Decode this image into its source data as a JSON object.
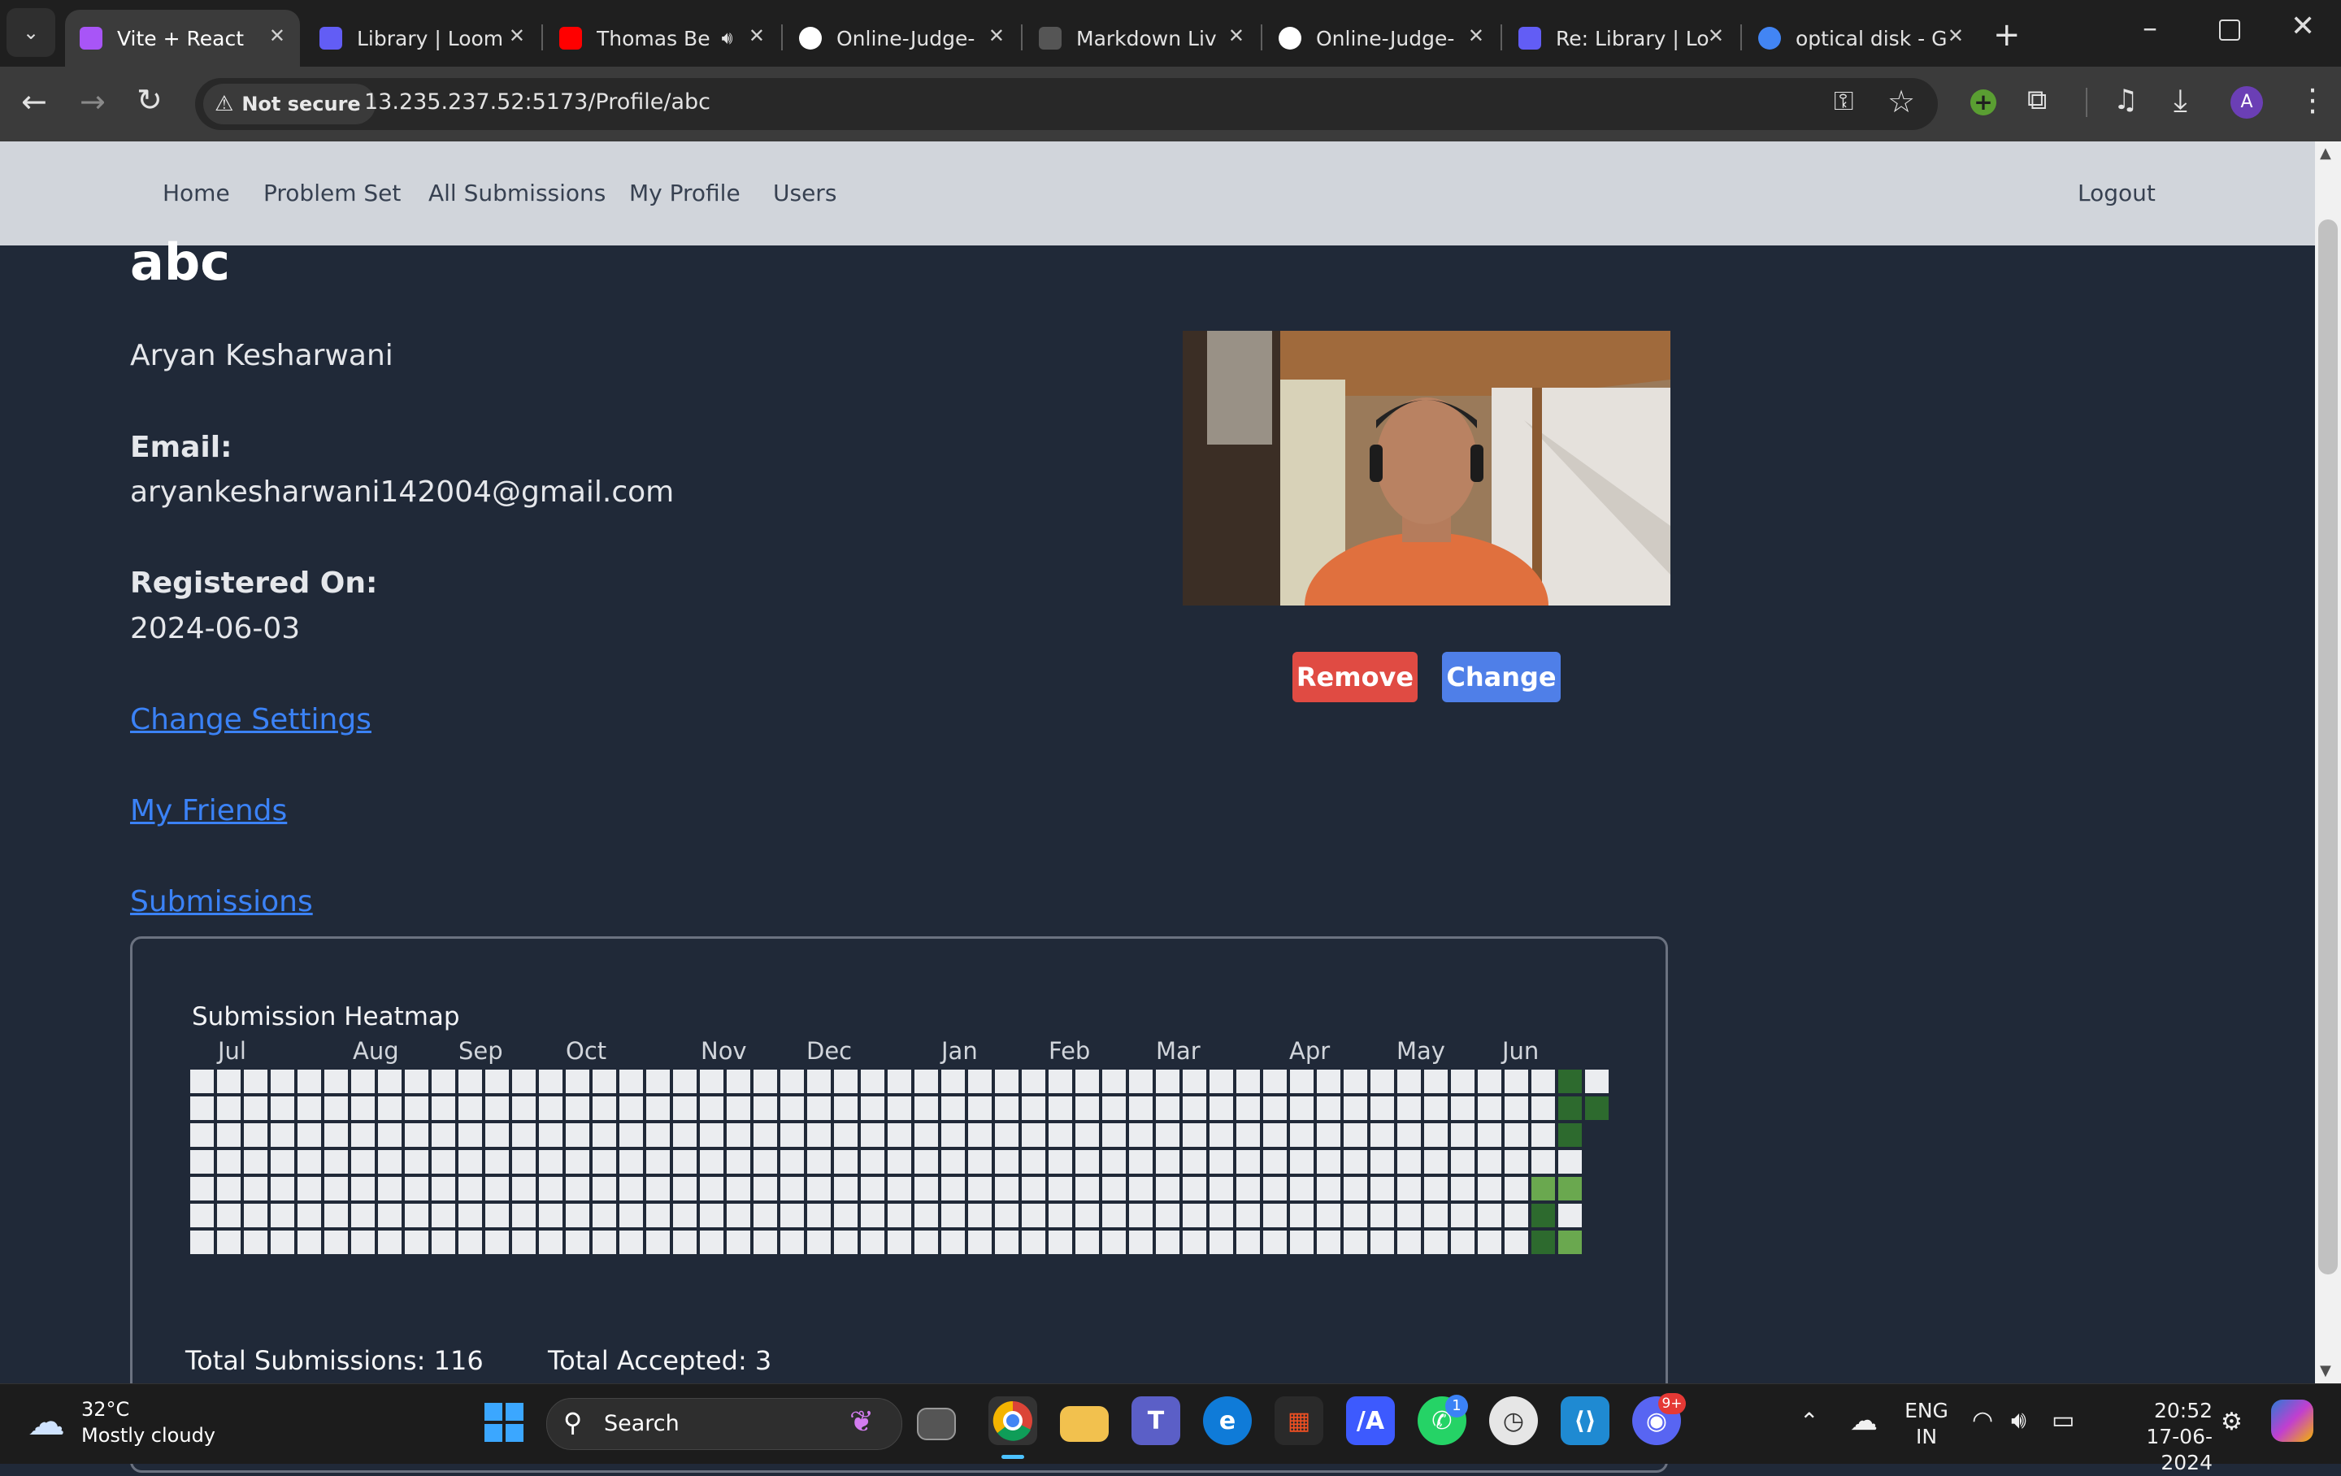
{
  "browser": {
    "tabs": [
      {
        "title": "Vite + React",
        "favicon": "vite-icon",
        "color": "#a855f7",
        "active": true
      },
      {
        "title": "Library | Loom",
        "favicon": "loom-icon",
        "color": "#625df5"
      },
      {
        "title": "Thomas Be",
        "favicon": "youtube-icon",
        "color": "#ff0000",
        "audio": true
      },
      {
        "title": "Online-Judge-",
        "favicon": "github-icon",
        "color": "#ffffff"
      },
      {
        "title": "Markdown Liv",
        "favicon": "markdown-icon",
        "color": "#555555"
      },
      {
        "title": "Online-Judge-",
        "favicon": "github-icon",
        "color": "#ffffff"
      },
      {
        "title": "Re: Library | Lo",
        "favicon": "loom-icon",
        "color": "#625df5"
      },
      {
        "title": "optical disk - G",
        "favicon": "google-icon",
        "color": "#4285f4"
      }
    ],
    "security_label": "Not secure",
    "url": "13.235.237.52:5173/Profile/abc",
    "profile_initial": "A"
  },
  "nav": {
    "links": [
      "Home",
      "Problem Set",
      "All Submissions",
      "My Profile",
      "Users"
    ],
    "logout": "Logout"
  },
  "profile": {
    "username": "abc",
    "full_name": "Aryan Kesharwani",
    "email_label": "Email:",
    "email": "aryankesharwani142004@gmail.com",
    "registered_label": "Registered On:",
    "registered": "2024-06-03",
    "links": {
      "settings": "Change Settings",
      "friends": "My Friends",
      "submissions": "Submissions"
    },
    "photo_buttons": {
      "remove": "Remove",
      "change": "Change"
    }
  },
  "heatmap": {
    "title": "Submission Heatmap",
    "months": [
      "Jul",
      "Aug",
      "Sep",
      "Oct",
      "Nov",
      "Dec",
      "Jan",
      "Feb",
      "Mar",
      "Apr",
      "May",
      "Jun"
    ],
    "weeks": 53,
    "active_cells": [
      {
        "week": 51,
        "day": 0,
        "level": 3
      },
      {
        "week": 51,
        "day": 1,
        "level": 3
      },
      {
        "week": 52,
        "day": 1,
        "level": 3
      },
      {
        "week": 51,
        "day": 2,
        "level": 3
      },
      {
        "week": 50,
        "day": 4,
        "level": 2
      },
      {
        "week": 51,
        "day": 4,
        "level": 2
      },
      {
        "week": 50,
        "day": 5,
        "level": 3
      },
      {
        "week": 50,
        "day": 6,
        "level": 3
      },
      {
        "week": 51,
        "day": 6,
        "level": 2
      }
    ],
    "colors": {
      "empty": "#ebedf0",
      "level2": "#6aa84f",
      "level3": "#2d6a2e"
    },
    "total_submissions": "Total Submissions: 116",
    "total_accepted": "Total Accepted: 3"
  },
  "taskbar": {
    "weather_temp": "32°C",
    "weather_desc": "Mostly cloudy",
    "search_placeholder": "Search",
    "whatsapp_badge": "1",
    "discord_badge": "9+",
    "lang_1": "ENG",
    "lang_2": "IN",
    "time": "20:52",
    "date": "17-06-2024"
  }
}
